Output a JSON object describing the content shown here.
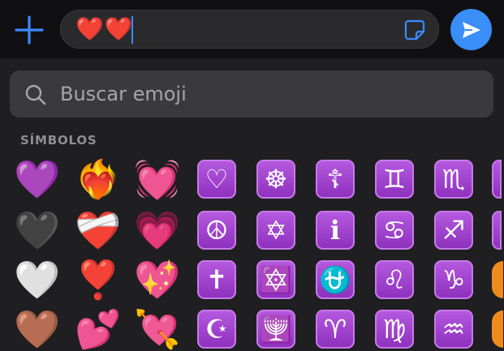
{
  "composer": {
    "message_text": "❤️❤️",
    "plus_icon": "plus-icon",
    "sticker_icon": "sticker-icon",
    "send_icon": "send-arrow-icon"
  },
  "search": {
    "placeholder": "Buscar emoji",
    "icon": "search-icon"
  },
  "section": {
    "label": "SÍMBOLOS"
  },
  "emoji_grid": {
    "rows": [
      [
        "💜",
        "❤️‍🔥",
        "💓",
        "♡",
        "☸",
        "☦",
        "♊",
        "♏",
        ""
      ],
      [
        "🖤",
        "❤️‍🩹",
        "💗",
        "☮",
        "✡",
        "ℹ",
        "♋",
        "♐",
        ""
      ],
      [
        "🤍",
        "❣️",
        "💖",
        "✝",
        "🔯",
        "⛎",
        "♌",
        "♑",
        ""
      ],
      [
        "🤎",
        "💕",
        "💘",
        "☪",
        "🕎",
        "♈",
        "♍",
        "♒",
        ""
      ]
    ]
  },
  "colors": {
    "accent": "#3a8ef7",
    "tile": "#a046d0",
    "background": "#1f1f21"
  }
}
